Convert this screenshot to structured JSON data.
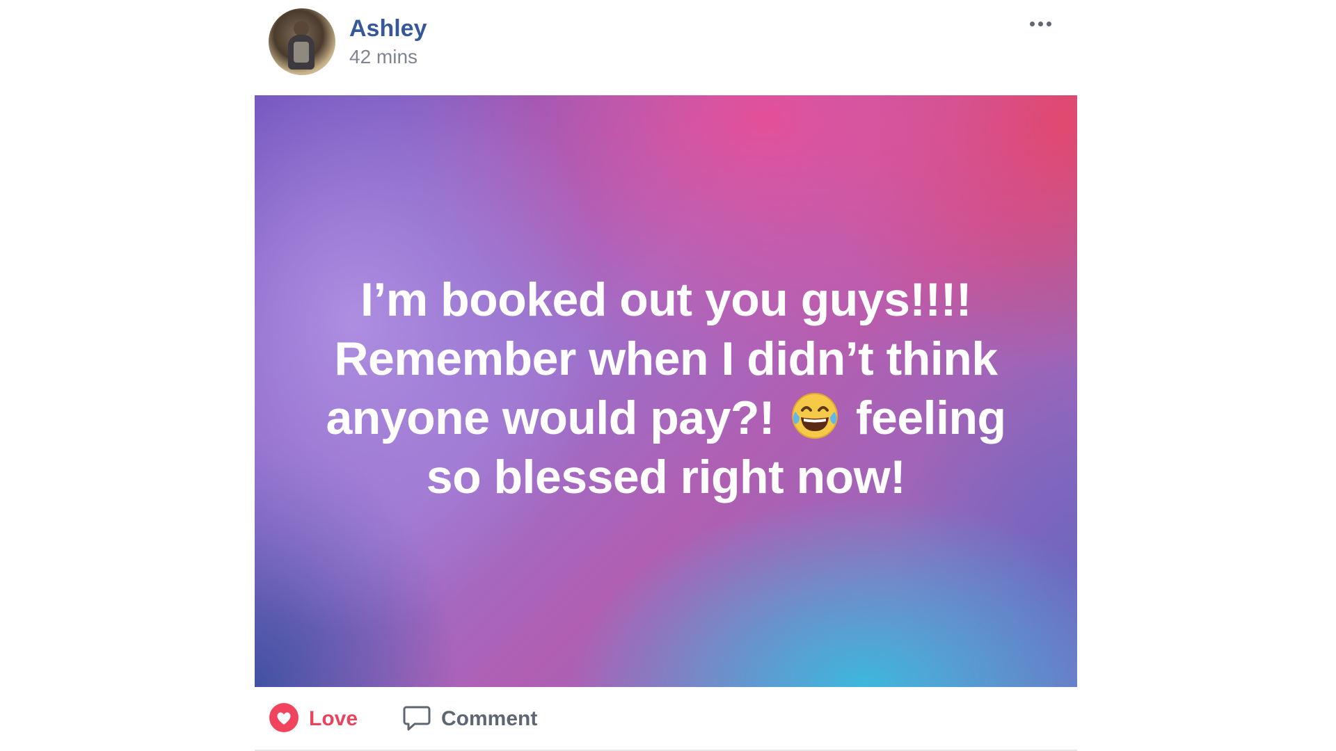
{
  "post": {
    "author": {
      "name": "Ashley",
      "avatar_icon": "profile-photo"
    },
    "timestamp": "42 mins",
    "more_icon": "ellipsis-horizontal-icon",
    "text_line_1": "I’m booked out you guys!!!!",
    "text_line_2": "Remember when I didn’t think",
    "text_line_3_before": "anyone would pay?!",
    "text_line_3_after": "feeling",
    "text_line_4": "so blessed right now!",
    "emoji_icon": "tears-of-joy-emoji",
    "background_colors": [
      "#6a4cb8",
      "#b05fb2",
      "#e84e96",
      "#e24662",
      "#38bcde",
      "#3c50a0"
    ]
  },
  "actions": {
    "love_label": "Love",
    "love_icon": "heart-icon",
    "love_color": "#e9445e",
    "comment_label": "Comment",
    "comment_icon": "comment-bubble-icon",
    "comment_color": "#5f6673"
  },
  "colors": {
    "author_name": "#365899",
    "timestamp": "#7f8590"
  }
}
